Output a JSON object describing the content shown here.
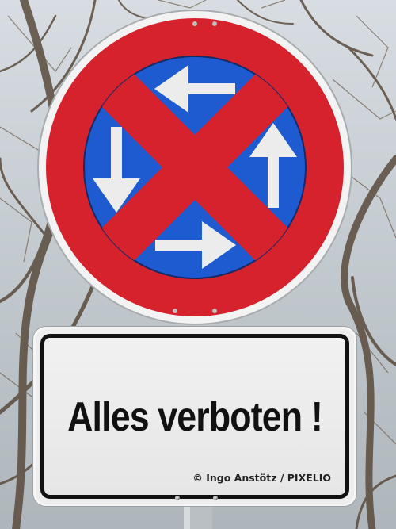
{
  "sign": {
    "type": "no-stopping-sign",
    "colors": {
      "red": "#d6222c",
      "blue": "#1e5bd0",
      "white": "#f3f3f3",
      "arrow": "#ececec"
    },
    "arrows": [
      "arrow-left-icon",
      "arrow-down-icon",
      "arrow-up-icon",
      "arrow-right-icon"
    ]
  },
  "plate": {
    "text": "Alles verboten !",
    "credit": "© Ingo Anstötz / PIXELIO"
  }
}
